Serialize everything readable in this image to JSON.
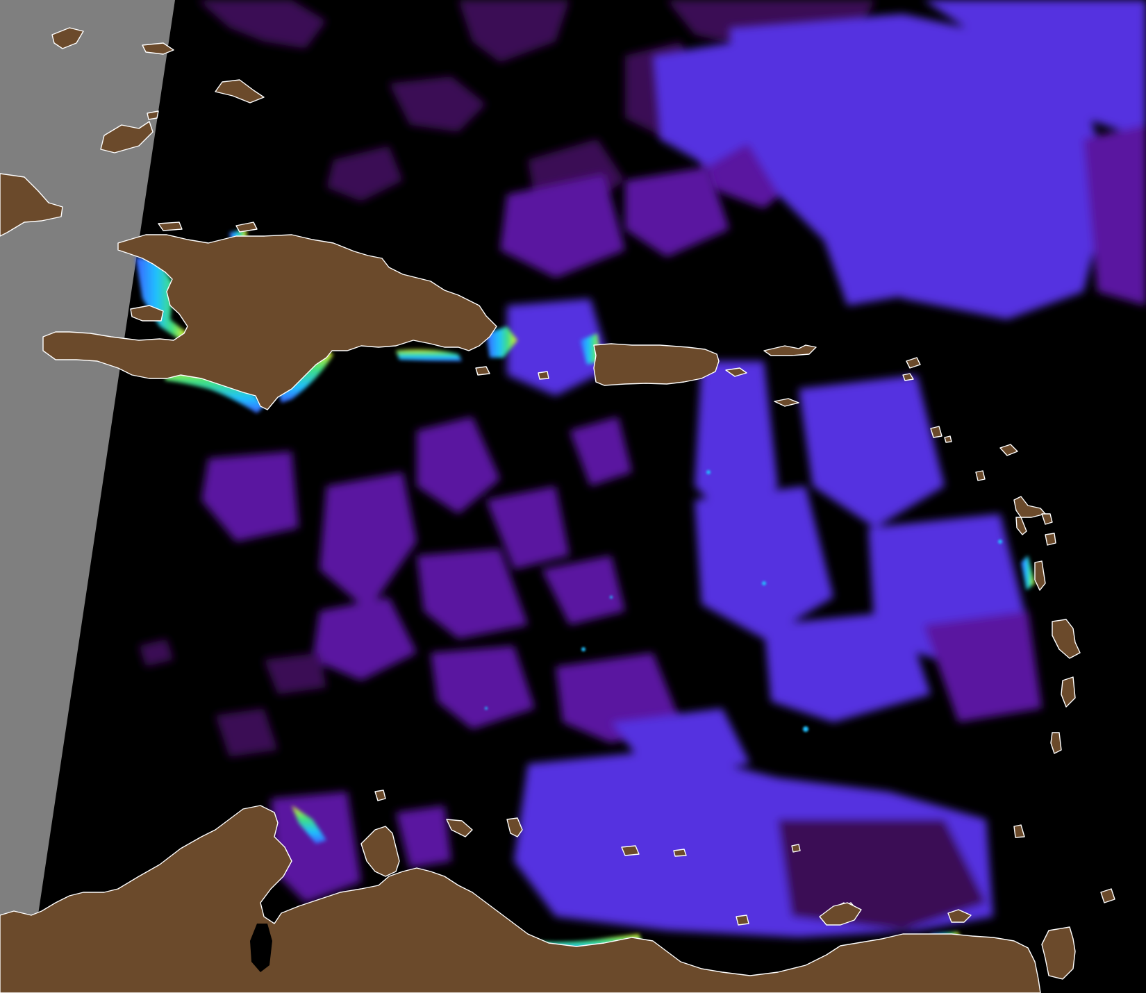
{
  "map": {
    "colors": {
      "ocean_nodata": "#000000",
      "outside_swath": "#7f7f7f",
      "land": "#6b4a2b",
      "coastline": "#ffffff",
      "low_dark_purple": "#3a0a55",
      "low_purple": "#5a16a0",
      "mid_blue_violet": "#5530e0",
      "mid_blue": "#3a60ff",
      "high_cyan": "#20c0ff",
      "high_green": "#40e080",
      "highest_yellow": "#f0f020"
    }
  }
}
